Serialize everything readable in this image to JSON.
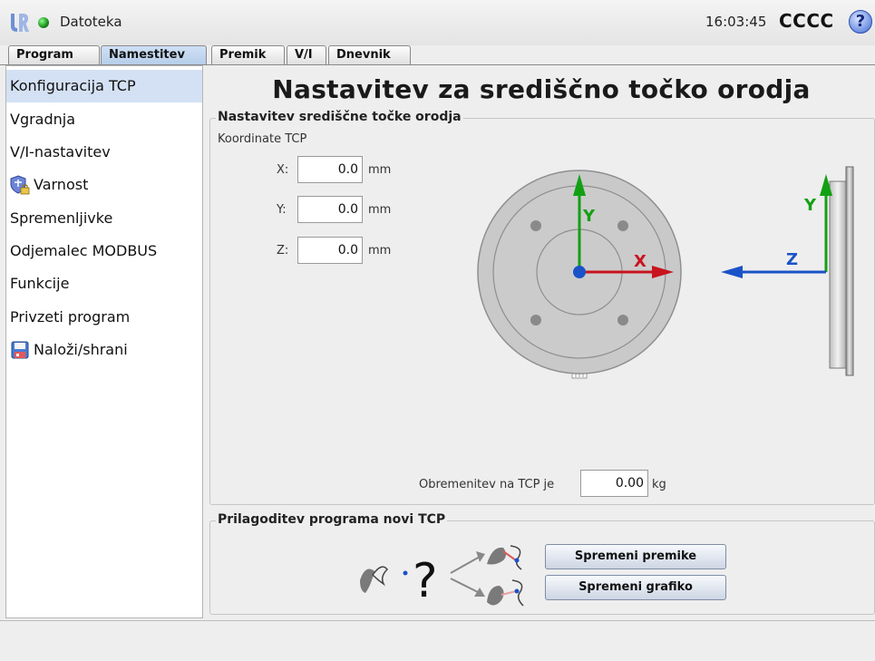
{
  "app": {
    "title": "Datoteka",
    "clock": "16:03:45",
    "robot_name": "CCCC",
    "help_label": "?"
  },
  "tabs": [
    {
      "label": "Program",
      "active": false
    },
    {
      "label": "Namestitev",
      "active": true
    },
    {
      "label": "Premik",
      "active": false
    },
    {
      "label": "V/I",
      "active": false
    },
    {
      "label": "Dnevnik",
      "active": false
    }
  ],
  "sidebar": {
    "items": [
      {
        "label": "Konfiguracija TCP",
        "icon": "",
        "selected": true
      },
      {
        "label": "Vgradnja",
        "icon": ""
      },
      {
        "label": "V/I-nastavitev",
        "icon": ""
      },
      {
        "label": "Varnost",
        "icon": "shield-lock-icon"
      },
      {
        "label": "Spremenljivke",
        "icon": ""
      },
      {
        "label": "Odjemalec MODBUS",
        "icon": ""
      },
      {
        "label": "Funkcije",
        "icon": ""
      },
      {
        "label": "Privzeti program",
        "icon": ""
      },
      {
        "label": "Naloži/shrani",
        "icon": "floppy-disk-icon"
      }
    ]
  },
  "main": {
    "page_title": "Nastavitev za središčno točko orodja",
    "tcp_group": {
      "title": "Nastavitev središčne točke orodja",
      "coords_label": "Koordinate TCP",
      "fields": [
        {
          "axis": "X:",
          "value": "0.0",
          "unit": "mm"
        },
        {
          "axis": "Y:",
          "value": "0.0",
          "unit": "mm"
        },
        {
          "axis": "Z:",
          "value": "0.0",
          "unit": "mm"
        }
      ],
      "diagram_labels": {
        "x": "X",
        "y": "Y",
        "side_y": "Y",
        "side_z": "Z"
      },
      "payload_label": "Obremenitev na TCP je",
      "payload_value": "0.00",
      "payload_unit": "kg"
    },
    "adjust_group": {
      "title": "Prilagoditev programa novi TCP",
      "question_mark": "?",
      "change_moves_button": "Spremeni premike",
      "change_graphics_button": "Spremeni grafiko"
    }
  },
  "colors": {
    "x_axis": "#c8141e",
    "y_axis": "#12a012",
    "z_axis": "#1a52c8",
    "selection": "#d4e1f4"
  }
}
